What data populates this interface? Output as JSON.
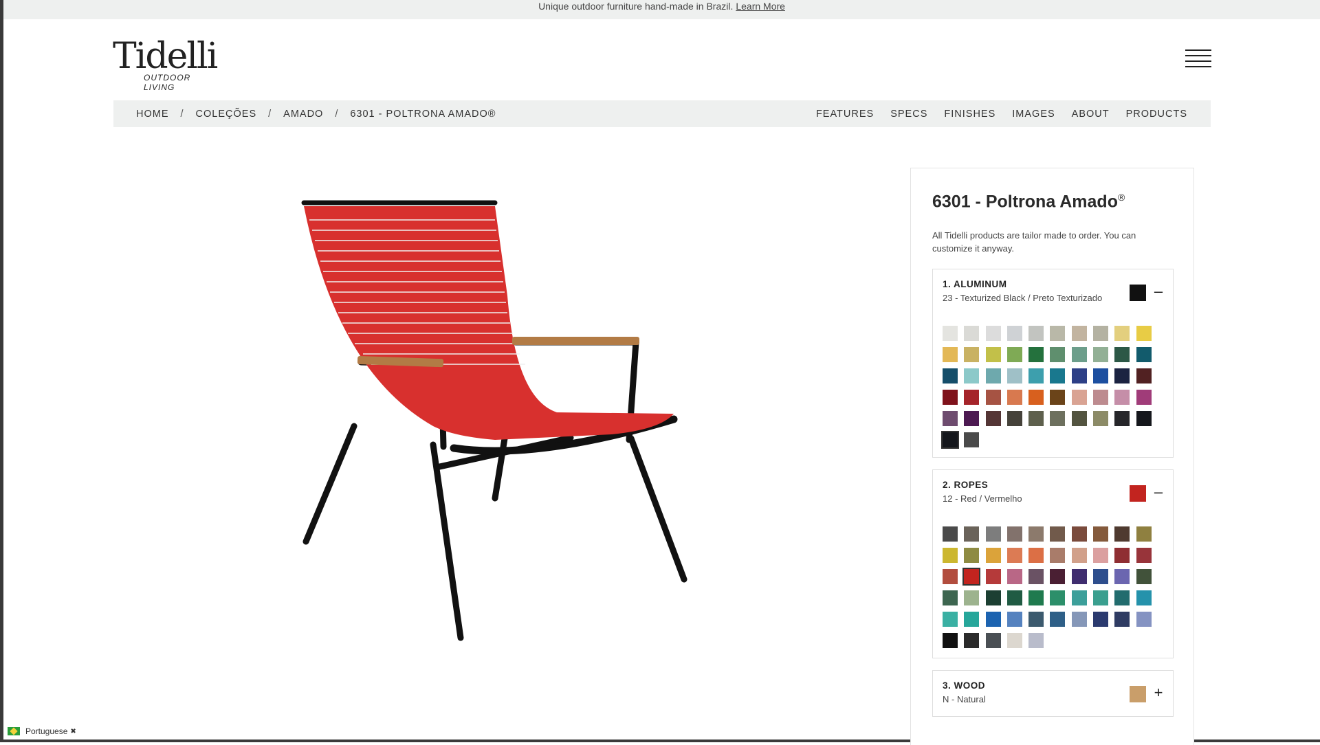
{
  "announce": {
    "text": "Unique outdoor furniture hand-made in Brazil.",
    "link": "Learn More"
  },
  "brand": {
    "name": "Tidelli",
    "tagline": "OUTDOOR LIVING"
  },
  "breadcrumb": [
    "HOME",
    "COLEÇÕES",
    "AMADO",
    "6301 - POLTRONA AMADO®"
  ],
  "subnav": [
    "FEATURES",
    "SPECS",
    "FINISHES",
    "IMAGES",
    "ABOUT",
    "PRODUCTS"
  ],
  "product": {
    "title": "6301 - Poltrona Amado",
    "title_mark": "®",
    "intro": "All Tidelli products are tailor made to order. You can customize it anyway."
  },
  "options": [
    {
      "title": "1. ALUMINUM",
      "selected": "23 - Texturized Black / Preto Texturizado",
      "chip": "#111111",
      "toggle": "–",
      "expanded": true,
      "swatches": [
        "#e4e4e0",
        "#dadad6",
        "#dcdcdc",
        "#cfd2d5",
        "#c2c4c0",
        "#b9b8a8",
        "#c2b4a0",
        "#b4b2a2",
        "#e3cf7e",
        "#e8cc45",
        "#e3b856",
        "#c9b263",
        "#c2c049",
        "#7faa55",
        "#24713d",
        "#5f8f6e",
        "#6c9e8b",
        "#92b095",
        "#2c5846",
        "#125b6c",
        "#154e6a",
        "#8cc9c9",
        "#6ea9ad",
        "#9fc0c7",
        "#3d9fad",
        "#19788e",
        "#2d3f86",
        "#1c4fa0",
        "#1b2341",
        "#512122",
        "#7f121b",
        "#a5242a",
        "#a65343",
        "#d8794f",
        "#d8601e",
        "#6b4419",
        "#d9a393",
        "#bd8b8f",
        "#c58ea8",
        "#a03c79",
        "#6e4c6f",
        "#4d1a52",
        "#543535",
        "#45423a",
        "#5e604d",
        "#6d705e",
        "#535440",
        "#8c8b67",
        "#26262a",
        "#15171c",
        "#15171c",
        "#4a4a4a"
      ],
      "selected_index": 50
    },
    {
      "title": "2. ROPES",
      "selected": "12 - Red / Vermelho",
      "chip": "#c2241f",
      "toggle": "–",
      "expanded": true,
      "swatches": [
        "#4a4a4a",
        "#6a635a",
        "#7d7d7d",
        "#82726c",
        "#8c7a6c",
        "#715a4b",
        "#7a4b3c",
        "#845a3c",
        "#4f3a30",
        "#8f8040",
        "#ccb72f",
        "#8e8b42",
        "#dba33a",
        "#dc7b54",
        "#dc6f45",
        "#a97c6a",
        "#d1a08a",
        "#dba0a0",
        "#8f2e33",
        "#98343a",
        "#b24d3e",
        "#c2241f",
        "#b53a3a",
        "#b96786",
        "#6a5264",
        "#4a1f33",
        "#3f2d6f",
        "#2e4e8d",
        "#6b66b0",
        "#41523a",
        "#3d6650",
        "#9db38e",
        "#1c3f32",
        "#205b43",
        "#1f7a4e",
        "#2c8f6a",
        "#3c9f9a",
        "#3a9f8f",
        "#226c6e",
        "#2592ab",
        "#3ab0a3",
        "#26a69a",
        "#1c63b0",
        "#5582bf",
        "#3c5a6e",
        "#2e5f87",
        "#8597b8",
        "#2b3a6f",
        "#2f3c63",
        "#8593c2",
        "#111111",
        "#2b2b2b",
        "#4a4f54",
        "#dcd7cf",
        "#b9bccb"
      ],
      "selected_index": 21
    },
    {
      "title": "3. WOOD",
      "selected": "N - Natural",
      "chip": "#c99e6a",
      "toggle": "+",
      "expanded": false,
      "swatches": []
    }
  ],
  "language": {
    "label": "Portuguese",
    "close": "✖"
  }
}
